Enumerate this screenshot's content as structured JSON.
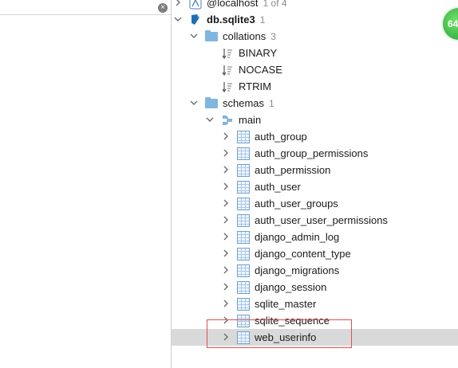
{
  "search": {
    "clear_glyph": "×"
  },
  "connection": {
    "label": "@localhost",
    "count": "1 of 4"
  },
  "database": {
    "label": "db.sqlite3",
    "count": "1"
  },
  "collations": {
    "label": "collations",
    "count": "3",
    "items": [
      "BINARY",
      "NOCASE",
      "RTRIM"
    ]
  },
  "schemas": {
    "label": "schemas",
    "count": "1"
  },
  "main": {
    "label": "main",
    "tables": [
      "auth_group",
      "auth_group_permissions",
      "auth_permission",
      "auth_user",
      "auth_user_groups",
      "auth_user_user_permissions",
      "django_admin_log",
      "django_content_type",
      "django_migrations",
      "django_session",
      "sqlite_master",
      "sqlite_sequence",
      "web_userinfo"
    ],
    "selected_table": "web_userinfo"
  },
  "badge": {
    "text": "64"
  },
  "colors": {
    "selection": "#d9d9d9",
    "highlight_border": "#e05050",
    "badge_green": "#23a033"
  }
}
